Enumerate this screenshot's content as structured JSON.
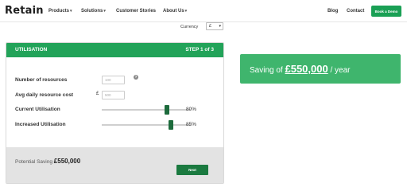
{
  "nav": {
    "logo": "Retain",
    "items": [
      {
        "label": "Products",
        "has_caret": true
      },
      {
        "label": "Solutions",
        "has_caret": true
      },
      {
        "label": "Customer Stories",
        "has_caret": false
      },
      {
        "label": "About Us",
        "has_caret": true
      }
    ],
    "blog": "Blog",
    "contact": "Contact",
    "cta": "Book a Demo",
    "caret_glyph": "▾"
  },
  "currency": {
    "label": "Currency",
    "value": "£",
    "caret": "▾"
  },
  "calculator": {
    "title": "UTILISATION",
    "step": "STEP 1 of 3",
    "fields": {
      "resources_label": "Number of resources",
      "resources_placeholder": "100",
      "help_glyph": "?",
      "cost_label": "Avg daily resource cost",
      "cost_currency": "£",
      "cost_placeholder": "500",
      "current_label": "Current Utilisation",
      "current_value": "80%",
      "current_level": 0.8,
      "increased_label": "Increased Utilisation",
      "increased_value": "85%",
      "increased_level": 0.85
    },
    "potential_label": "Potential Saving",
    "potential_amount": "£550,000",
    "next_label": "Next"
  },
  "saving_banner": {
    "prefix": "Saving of",
    "amount": "£550,000",
    "suffix": "/ year"
  },
  "colors": {
    "brand_green": "#22a359",
    "dark_green": "#1b7a40",
    "banner_green": "#3fb56d"
  },
  "icons": {
    "help": "question-icon",
    "caret": "chevron-down-icon"
  }
}
